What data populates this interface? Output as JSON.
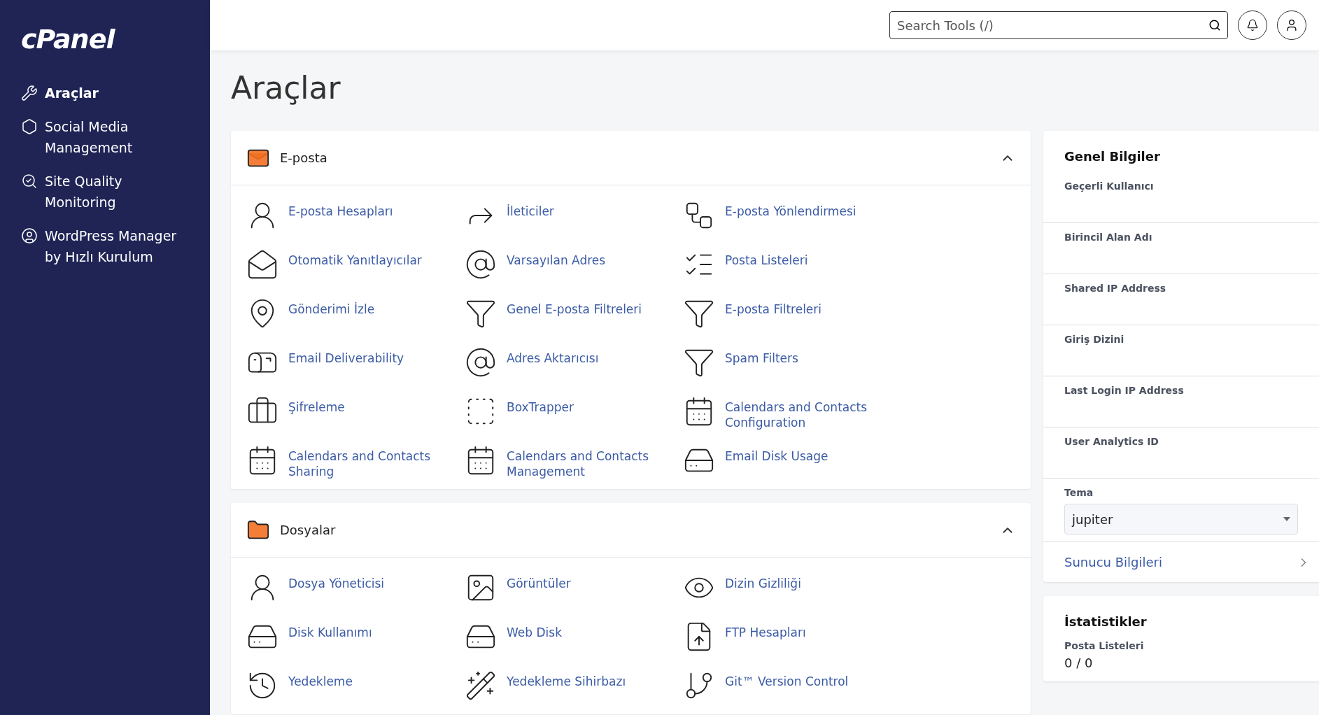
{
  "sidebar": {
    "logo": "cPanel",
    "items": [
      {
        "label": "Araçlar",
        "selected": true
      },
      {
        "label": "Social Media Management",
        "selected": false
      },
      {
        "label": "Site Quality Monitoring",
        "selected": false
      },
      {
        "label": "WordPress Manager by Hızlı Kurulum",
        "selected": false
      }
    ]
  },
  "topbar": {
    "search": {
      "placeholder": "Search Tools (/)"
    }
  },
  "page_title": "Araçlar",
  "sections": [
    {
      "title": "E-posta",
      "expanded": true,
      "items": [
        "E-posta Hesapları",
        "İleticiler",
        "E-posta Yönlendirmesi",
        "Otomatik Yanıtlayıcılar",
        "Varsayılan Adres",
        "Posta Listeleri",
        "Gönderimi İzle",
        "Genel E-posta Filtreleri",
        "E-posta Filtreleri",
        "Email Deliverability",
        "Adres Aktarıcısı",
        "Spam Filters",
        "Şifreleme",
        "BoxTrapper",
        "Calendars and Contacts Configuration",
        "Calendars and Contacts Sharing",
        "Calendars and Contacts Management",
        "Email Disk Usage"
      ]
    },
    {
      "title": "Dosyalar",
      "expanded": true,
      "items": [
        "Dosya Yöneticisi",
        "Görüntüler",
        "Dizin Gizliliği",
        "Disk Kullanımı",
        "Web Disk",
        "FTP Hesapları",
        "Yedekleme",
        "Yedekleme Sihirbazı",
        "Git™ Version Control"
      ]
    }
  ],
  "general_info": {
    "title": "Genel Bilgiler",
    "fields": [
      "Geçerli Kullanıcı",
      "Birincil Alan Adı",
      "Shared IP Address",
      "Giriş Dizini",
      "Last Login IP Address",
      "User Analytics ID"
    ],
    "theme": {
      "label": "Tema",
      "value": "jupiter"
    },
    "server_link": "Sunucu Bilgileri"
  },
  "statistics": {
    "title": "İstatistikler",
    "rows": [
      {
        "label": "Posta Listeleri",
        "value": "0 / 0"
      }
    ]
  }
}
